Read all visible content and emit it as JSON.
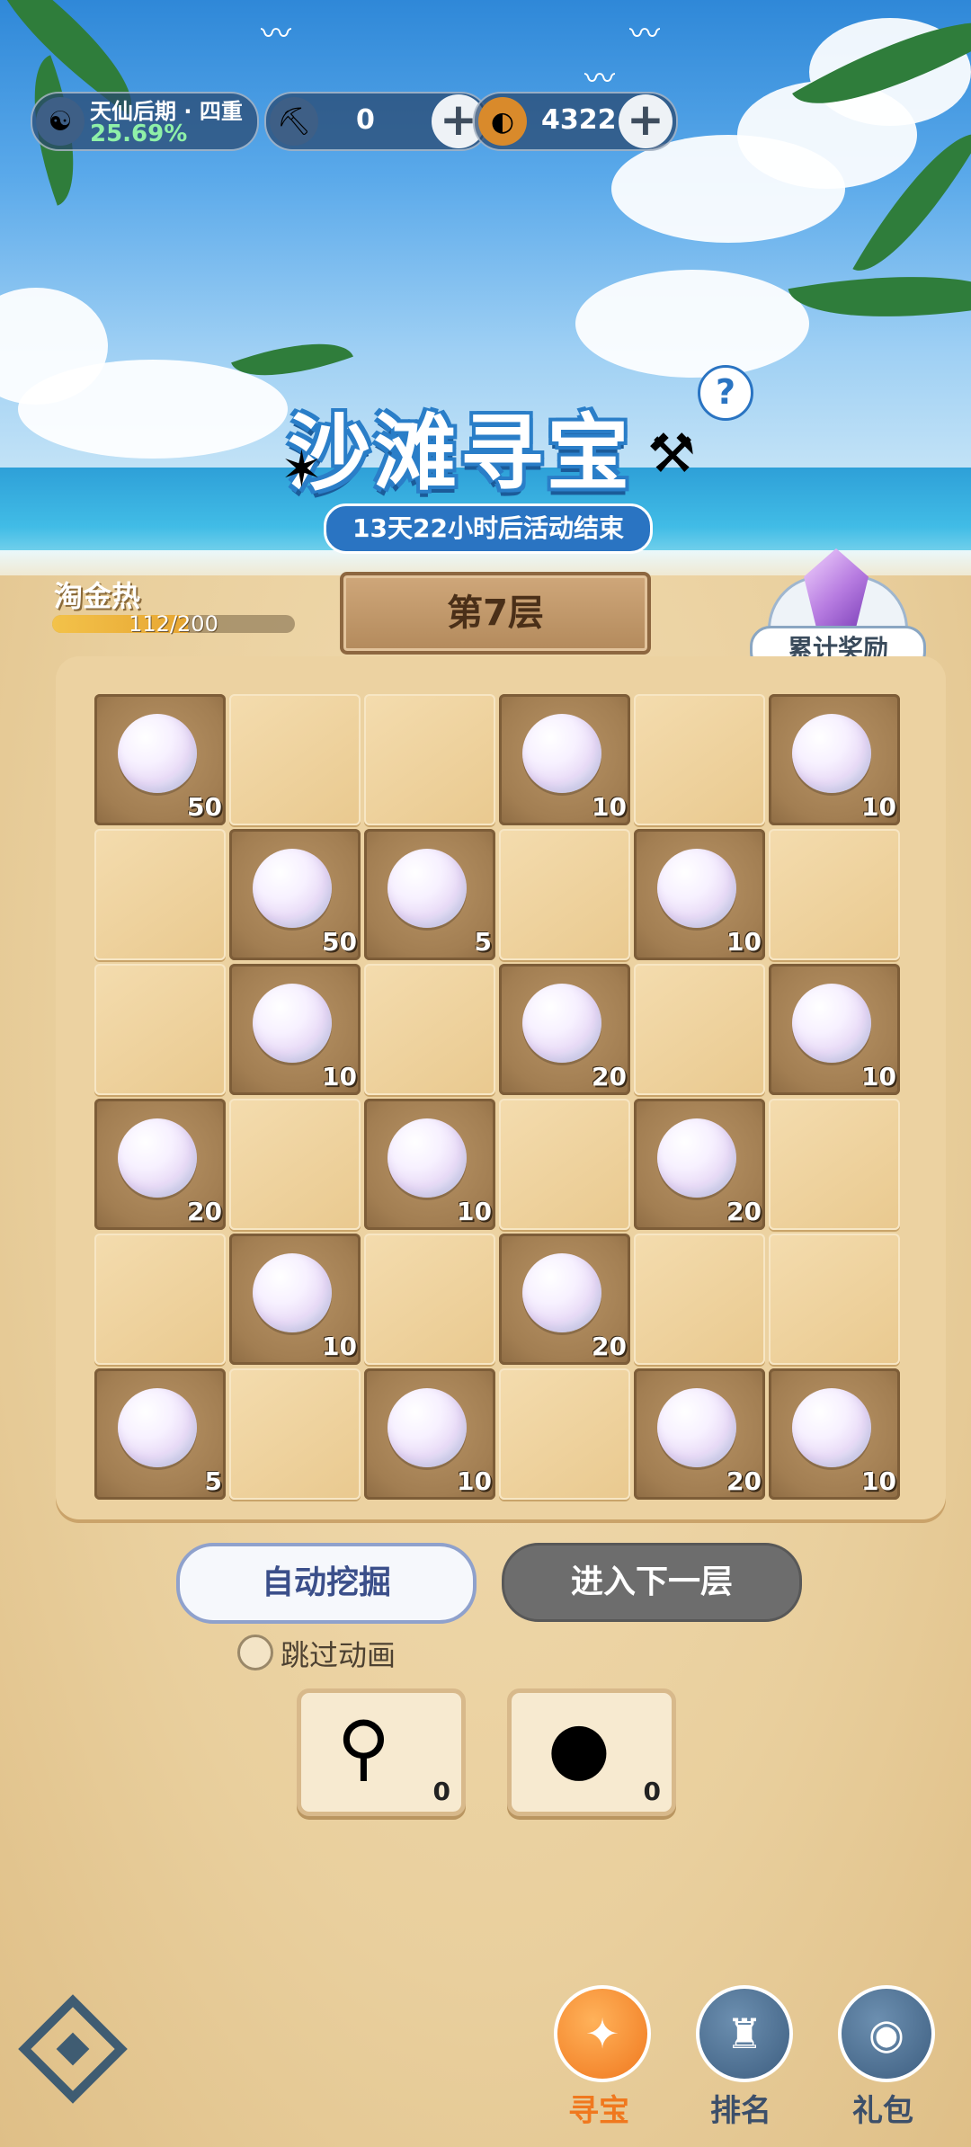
{
  "top_bar": {
    "realm_name": "天仙后期 · 四重",
    "realm_percent": "25.69%",
    "shovel_count": "0",
    "coin_count": "4322",
    "plus_symbol": "+"
  },
  "event": {
    "title": "沙滩寻宝",
    "countdown": "13天22小时后活动结束",
    "help_symbol": "?"
  },
  "heat": {
    "label": "淘金热",
    "value_text": "112/200",
    "progress": 0.56
  },
  "floor_label": "第7层",
  "reward_label": "累计奖励",
  "board": [
    [
      {
        "open": true,
        "count": "50"
      },
      {
        "open": false
      },
      {
        "open": false
      },
      {
        "open": true,
        "count": "10"
      },
      {
        "open": false
      },
      {
        "open": true,
        "count": "10"
      }
    ],
    [
      {
        "open": false
      },
      {
        "open": true,
        "count": "50"
      },
      {
        "open": true,
        "count": "5"
      },
      {
        "open": false
      },
      {
        "open": true,
        "count": "10"
      },
      {
        "open": false
      }
    ],
    [
      {
        "open": false
      },
      {
        "open": true,
        "count": "10"
      },
      {
        "open": false
      },
      {
        "open": true,
        "count": "20"
      },
      {
        "open": false
      },
      {
        "open": true,
        "count": "10"
      }
    ],
    [
      {
        "open": true,
        "count": "20"
      },
      {
        "open": false
      },
      {
        "open": true,
        "count": "10"
      },
      {
        "open": false
      },
      {
        "open": true,
        "count": "20"
      },
      {
        "open": false
      }
    ],
    [
      {
        "open": false
      },
      {
        "open": true,
        "count": "10"
      },
      {
        "open": false
      },
      {
        "open": true,
        "count": "20"
      },
      {
        "open": false
      },
      {
        "open": false
      }
    ],
    [
      {
        "open": true,
        "count": "5"
      },
      {
        "open": false
      },
      {
        "open": true,
        "count": "10"
      },
      {
        "open": false
      },
      {
        "open": true,
        "count": "20"
      },
      {
        "open": true,
        "count": "10"
      }
    ]
  ],
  "actions": {
    "auto_dig": "自动挖掘",
    "next_floor": "进入下一层",
    "skip_animation": "跳过动画"
  },
  "tools": [
    {
      "icon": "magnifier-icon",
      "count": "0"
    },
    {
      "icon": "bomb-icon",
      "count": "0"
    }
  ],
  "nav": [
    {
      "label": "寻宝",
      "icon": "treasure-icon",
      "active": true
    },
    {
      "label": "排名",
      "icon": "ranking-icon",
      "active": false
    },
    {
      "label": "礼包",
      "icon": "gift-pack-icon",
      "active": false
    }
  ],
  "colors": {
    "accent_blue": "#2a74c2",
    "active_orange": "#f0781e",
    "sand": "#e9cf9d"
  }
}
